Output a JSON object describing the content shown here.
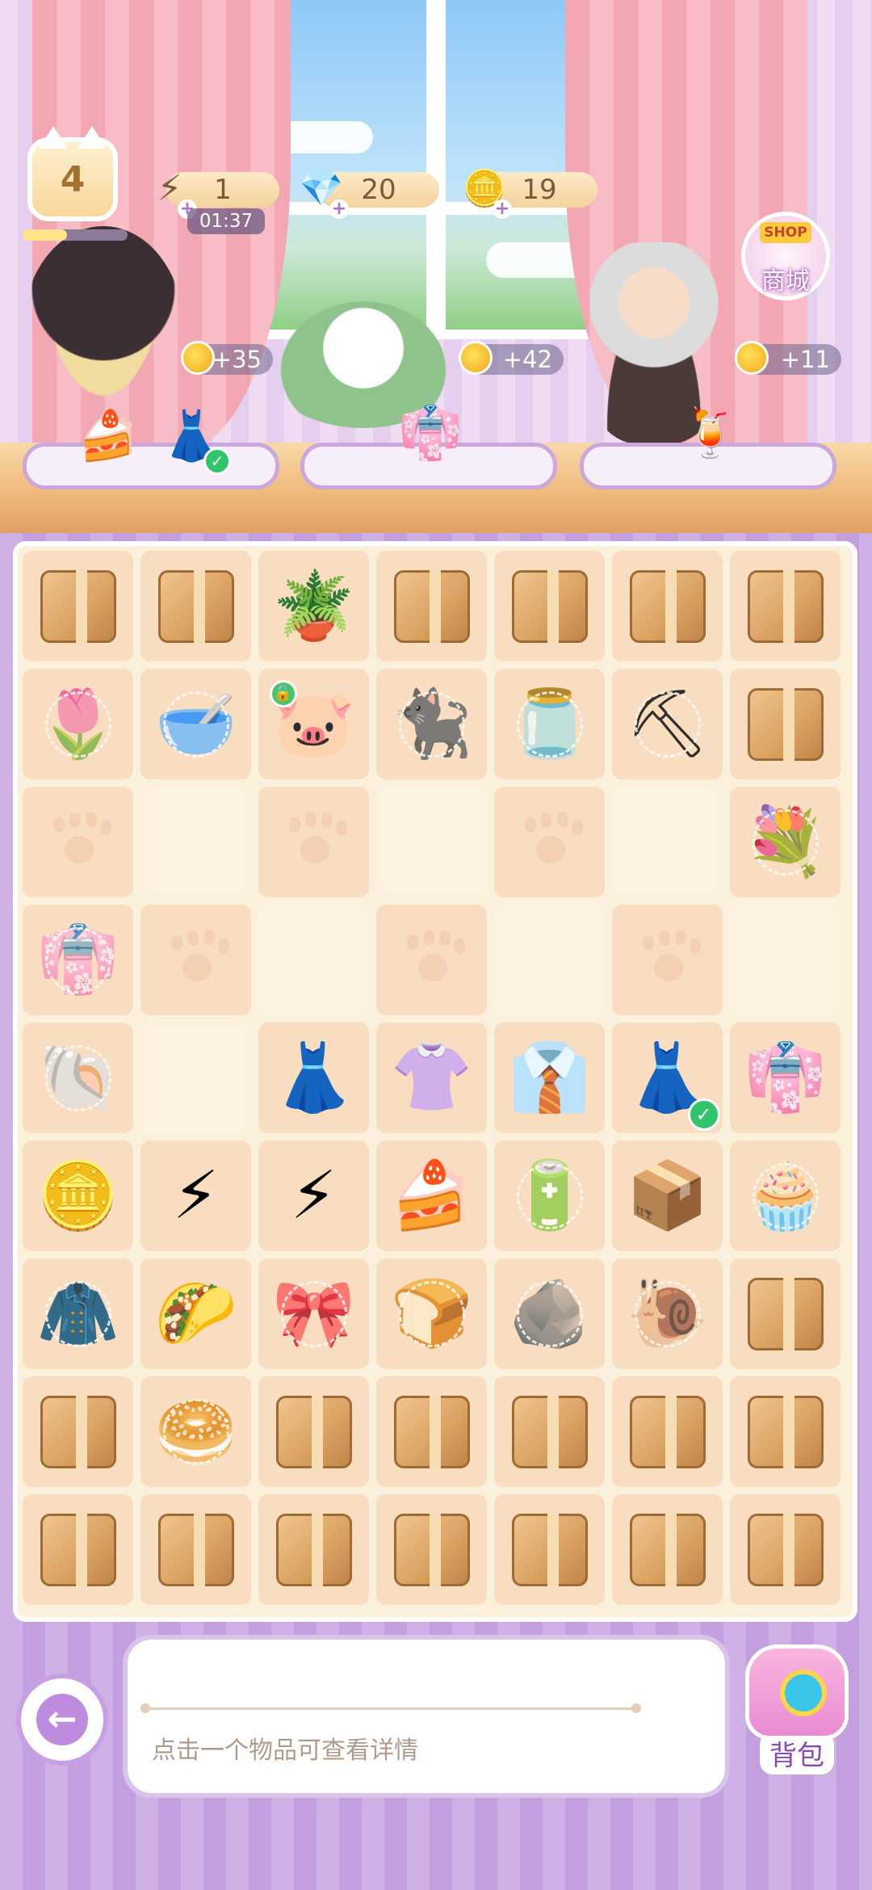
{
  "hud": {
    "level": "4",
    "level_progress": 0.42,
    "energy": "1",
    "energy_timer": "01:37",
    "gems": "20",
    "coins": "19"
  },
  "orders": [
    {
      "reward": "+35",
      "items": [
        "cake",
        "pink-dress"
      ],
      "completed_item": "pink-dress"
    },
    {
      "reward": "+42",
      "items": [
        "pink-kimono"
      ]
    },
    {
      "reward": "+11",
      "items": [
        "strawberry-drink"
      ]
    }
  ],
  "shop": {
    "tag": "SHOP",
    "label": "商城"
  },
  "board": {
    "rows": [
      [
        "box",
        "box",
        "watering-can",
        "box",
        "box",
        "box",
        "box"
      ],
      [
        "tulip",
        "bowl-brown",
        "piggy-bank",
        "cat",
        "bowl-teal",
        "shovel",
        "box"
      ],
      [
        "paw",
        "empty",
        "paw",
        "empty",
        "paw",
        "empty",
        "flower-bouquet"
      ],
      [
        "kimono-webbed",
        "paw",
        "empty",
        "paw",
        "empty",
        "paw",
        "empty"
      ],
      [
        "pearl-shell",
        "empty",
        "white-dress",
        "green-outfit",
        "office-outfit",
        "pink-dress",
        "white-skirt-outfit"
      ],
      [
        "coin",
        "energy-2",
        "energy-3",
        "cake",
        "energy-rack",
        "energy-box",
        "cupcake"
      ],
      [
        "gray-coat",
        "taco-hamster",
        "hair-scrunchie",
        "bun",
        "purple-stone",
        "ammonite",
        "box"
      ],
      [
        "box",
        "bagel",
        "box",
        "box",
        "box",
        "box",
        "box"
      ],
      [
        "box",
        "box",
        "box",
        "box",
        "box",
        "box",
        "box"
      ]
    ]
  },
  "hint": "点击一个物品可查看详情",
  "bag_label": "背包",
  "icons": {
    "watering-can": "🪴",
    "tulip": "🌷",
    "bowl-brown": "🥣",
    "piggy-bank": "🐷",
    "cat": "🐈‍⬛",
    "bowl-teal": "🫙",
    "shovel": "⛏",
    "flower-bouquet": "💐",
    "kimono-webbed": "👘",
    "pearl-shell": "🐚",
    "white-dress": "👗",
    "green-outfit": "👚",
    "office-outfit": "👔",
    "pink-dress": "👗",
    "white-skirt-outfit": "👘",
    "coin": "🪙",
    "energy-2": "⚡",
    "energy-3": "⚡",
    "cake": "🍰",
    "energy-rack": "🔋",
    "energy-box": "📦",
    "cupcake": "🧁",
    "gray-coat": "🧥",
    "taco-hamster": "🌮",
    "hair-scrunchie": "🎀",
    "bun": "🍞",
    "purple-stone": "🪨",
    "ammonite": "🐌",
    "bagel": "🥯"
  },
  "webbed": [
    "tulip",
    "bowl-brown",
    "cat",
    "bowl-teal",
    "shovel",
    "flower-bouquet",
    "kimono-webbed",
    "pearl-shell",
    "energy-rack",
    "cupcake",
    "gray-coat",
    "hair-scrunchie",
    "bun",
    "purple-stone",
    "ammonite",
    "bagel"
  ],
  "unlocked_cell": {
    "row": 1,
    "col": 2
  },
  "checked_cell": {
    "row": 4,
    "col": 5
  }
}
